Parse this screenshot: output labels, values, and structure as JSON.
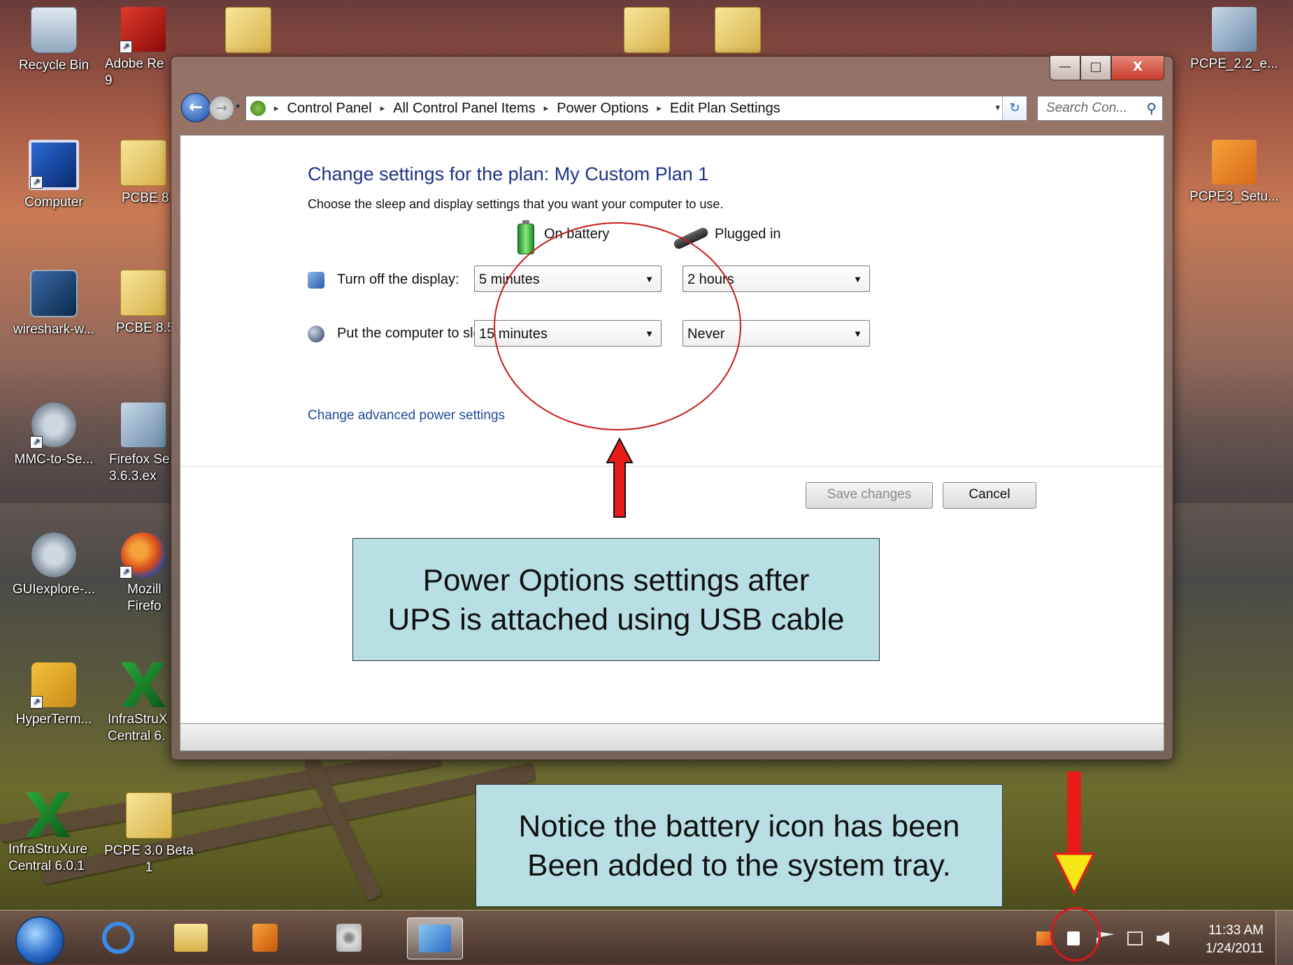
{
  "desktop": {
    "icons": [
      {
        "label": "Recycle Bin"
      },
      {
        "label": "Adobe Re\n9"
      },
      {
        "label": "Computer"
      },
      {
        "label": "PCBE 8"
      },
      {
        "label": "wireshark-w..."
      },
      {
        "label": "PCBE 8.5"
      },
      {
        "label": "MMC-to-Se..."
      },
      {
        "label": "Firefox Se\n3.6.3.ex"
      },
      {
        "label": "GUIexplore-..."
      },
      {
        "label": "Mozill\nFirefo"
      },
      {
        "label": "HyperTerm..."
      },
      {
        "label": "InfraStruX\nCentral 6."
      },
      {
        "label": "InfraStruXure\nCentral 6.0.1"
      },
      {
        "label": "PCPE 3.0 Beta\n1"
      },
      {
        "label": "PCPE_2.2_e..."
      },
      {
        "label": "PCPE3_Setu..."
      }
    ]
  },
  "window": {
    "controls": {
      "minimize": "—",
      "maximize": "□",
      "close": "X"
    },
    "nav": {
      "back": "←",
      "forward": "→",
      "dropdown": "▾"
    },
    "breadcrumb": [
      "Control Panel",
      "All Control Panel Items",
      "Power Options",
      "Edit Plan Settings"
    ],
    "breadcrumb_sep": "▸",
    "address_dropdown": "▾",
    "refresh": "↻",
    "search_placeholder": "Search Con...",
    "search_icon": "⚲",
    "heading": "Change settings for the plan: My Custom Plan 1",
    "subtext": "Choose the sleep and display settings that you want your computer to use.",
    "columns": {
      "battery": "On battery",
      "plugged": "Plugged in"
    },
    "rows": [
      {
        "label": "Turn off the display:",
        "battery": "5 minutes",
        "plugged": "2 hours"
      },
      {
        "label": "Put the computer to sleep:",
        "battery": "15 minutes",
        "plugged": "Never"
      }
    ],
    "select_arrow": "▼",
    "advanced_link": "Change advanced power settings",
    "save_button": "Save changes",
    "cancel_button": "Cancel"
  },
  "annotations": {
    "callout_top": "Power Options settings after\nUPS is attached using USB cable",
    "callout_bottom": "Notice the battery icon has been\nBeen added to the system tray."
  },
  "taskbar": {
    "clock_time": "11:33 AM",
    "clock_date": "1/24/2011"
  },
  "colors": {
    "heading": "#1e3287",
    "link": "#1e4a9a",
    "callout_bg": "#b8e0e4",
    "annotation_red": "#c81a1a",
    "arrow_yellow": "#f5e616"
  }
}
